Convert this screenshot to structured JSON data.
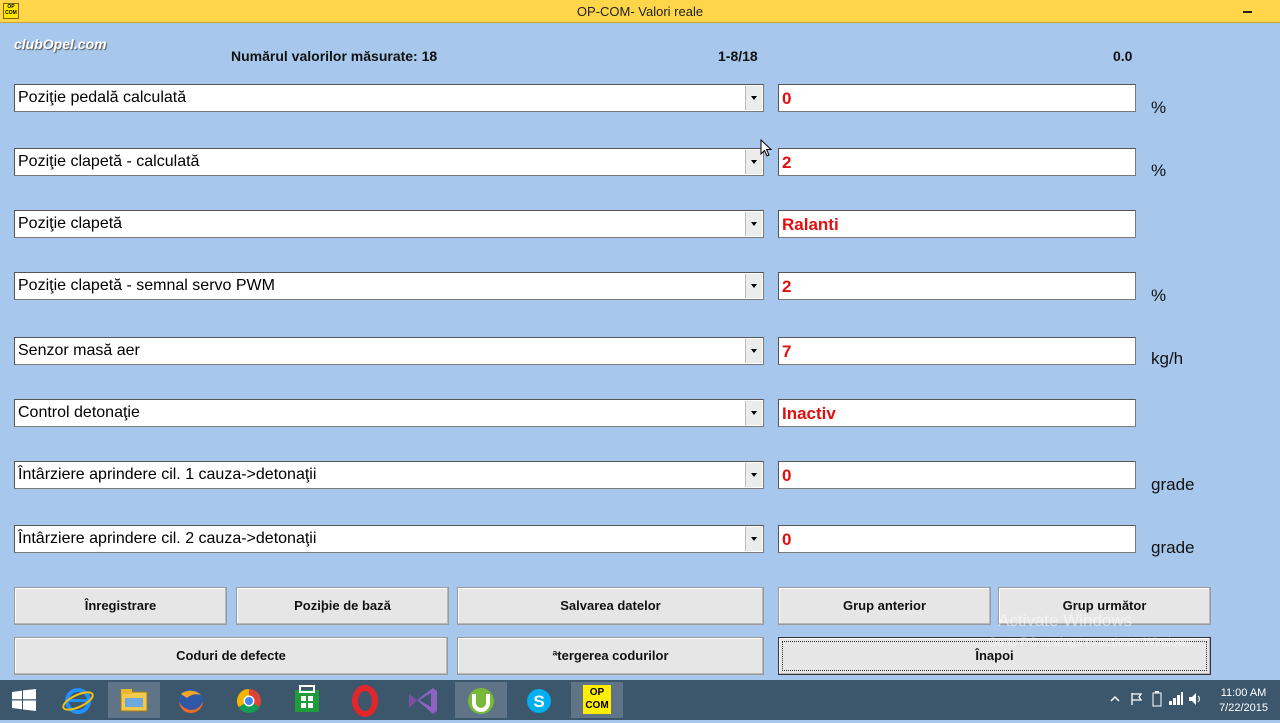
{
  "window": {
    "title": "OP-COM- Valori reale",
    "app_icon_text": "OP COM",
    "logo": "clubOpel.com"
  },
  "header": {
    "count_label": "Numărul valorilor măsurate: 18",
    "page_range": "1-8/18",
    "time_value": "0.0"
  },
  "rows": [
    {
      "label": "Poziţie pedală calculată",
      "value": "0",
      "unit": "%"
    },
    {
      "label": "Poziţie clapetă - calculată",
      "value": "2",
      "unit": "%"
    },
    {
      "label": "Poziţie clapetă",
      "value": "Ralanti",
      "unit": ""
    },
    {
      "label": "Poziţie clapetă - semnal servo PWM",
      "value": "2",
      "unit": "%"
    },
    {
      "label": "Senzor masă aer",
      "value": "7",
      "unit": "kg/h"
    },
    {
      "label": "Control detonaţie",
      "value": "Inactiv",
      "unit": ""
    },
    {
      "label": "Întârziere aprindere cil. 1 cauza->detonaţii",
      "value": "0",
      "unit": "grade"
    },
    {
      "label": "Întârziere aprindere cil. 2 cauza->detonaţii",
      "value": "0",
      "unit": "grade"
    }
  ],
  "buttons": {
    "record": "Înregistrare",
    "base_position": "Poziþie de bază",
    "save_data": "Salvarea datelor",
    "prev_group": "Grup anterior",
    "next_group": "Grup următor",
    "fault_codes": "Coduri de defecte",
    "clear_codes": "ªtergerea codurilor",
    "back": "Înapoi"
  },
  "watermark": {
    "line1": "Activate Windows",
    "line2": "Go to PC settings to activate Windows."
  },
  "taskbar": {
    "items": [
      "start-icon",
      "internet-explorer-icon",
      "file-explorer-icon",
      "firefox-icon",
      "chrome-icon",
      "store-icon",
      "opera-icon",
      "visual-studio-icon",
      "utorrent-icon",
      "skype-icon",
      "op-com-icon"
    ],
    "opcom_label": "OP COM",
    "time": "11:00 AM",
    "date": "7/22/2015"
  },
  "colors": {
    "background": "#a7c8ec",
    "value_text": "#e01010",
    "titlebar": "#ffd64a",
    "taskbar": "#3c566c"
  }
}
